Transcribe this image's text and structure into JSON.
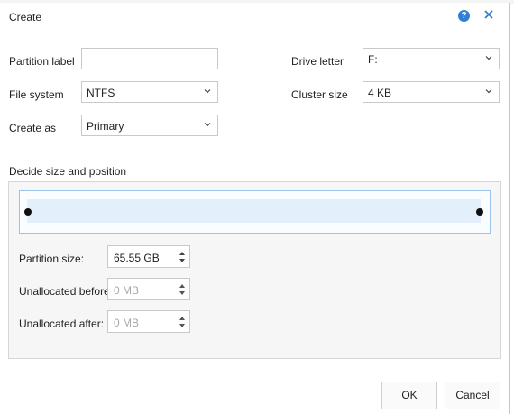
{
  "dialog": {
    "title": "Create"
  },
  "form": {
    "partition_label": {
      "label": "Partition label",
      "value": ""
    },
    "file_system": {
      "label": "File system",
      "value": "NTFS"
    },
    "create_as": {
      "label": "Create as",
      "value": "Primary"
    },
    "drive_letter": {
      "label": "Drive letter",
      "value": "F:"
    },
    "cluster_size": {
      "label": "Cluster size",
      "value": "4 KB"
    }
  },
  "size_position": {
    "heading": "Decide size and position",
    "partition_size": {
      "label": "Partition size:",
      "value": "65.55 GB"
    },
    "unallocated_before": {
      "label": "Unallocated before:",
      "value": "0 MB"
    },
    "unallocated_after": {
      "label": "Unallocated after:",
      "value": "0 MB"
    }
  },
  "buttons": {
    "ok": "OK",
    "cancel": "Cancel"
  },
  "colors": {
    "accent": "#2f7fd4",
    "bar_fill": "#e3effb"
  },
  "icons": {
    "help": "help-icon",
    "close": "close-icon",
    "dropdown": "chevron-down-icon",
    "spinner": "spinner-arrows-icon"
  }
}
